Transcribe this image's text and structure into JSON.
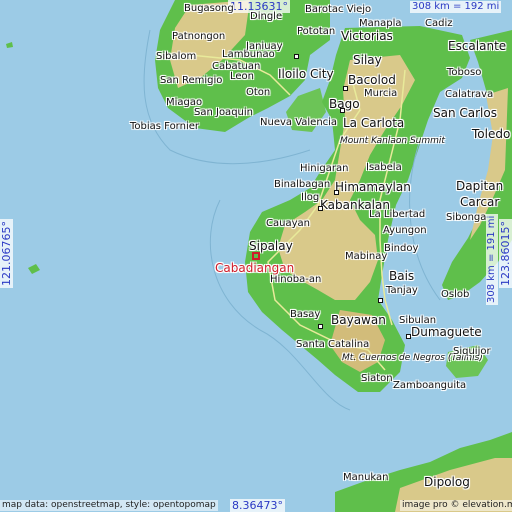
{
  "coordinates": {
    "north": "11.13631°",
    "south": "8.36473°",
    "west": "121.06765°",
    "east": "123.86015°"
  },
  "scale": {
    "horizontal": "308 km = 192 mi",
    "vertical": "308 km = 191 mi"
  },
  "attribution": {
    "left": "map data: openstreetmap, style: opentopomap",
    "right": "image pro © elevation.maps"
  },
  "highlight": {
    "name": "Cabadiangan",
    "color": "#d11d2a"
  },
  "colors": {
    "sea": "#9ccbe6",
    "lowland": "#5fbf4b",
    "hills": "#d9c98a",
    "coordinate_text": "#2a39c4"
  },
  "places": [
    {
      "name": "Bugasong"
    },
    {
      "name": "Dingle"
    },
    {
      "name": "Barotac Viejo"
    },
    {
      "name": "Cadiz"
    },
    {
      "name": "Patnongon"
    },
    {
      "name": "Pototan"
    },
    {
      "name": "Manapla"
    },
    {
      "name": "Victorias"
    },
    {
      "name": "Janiuay"
    },
    {
      "name": "Silay"
    },
    {
      "name": "Escalante"
    },
    {
      "name": "Lambunao"
    },
    {
      "name": "Cabatuan"
    },
    {
      "name": "Toboso"
    },
    {
      "name": "Sibalom"
    },
    {
      "name": "Leon"
    },
    {
      "name": "Iloilo City"
    },
    {
      "name": "Bacolod"
    },
    {
      "name": "Calatrava"
    },
    {
      "name": "Oton"
    },
    {
      "name": "Murcia"
    },
    {
      "name": "San Remigio"
    },
    {
      "name": "Miagao"
    },
    {
      "name": "San Joaquin"
    },
    {
      "name": "Bago"
    },
    {
      "name": "San Carlos"
    },
    {
      "name": "Nueva Valencia"
    },
    {
      "name": "Tobias Fornier"
    },
    {
      "name": "La Carlota"
    },
    {
      "name": "Toledo"
    },
    {
      "name": "Hinigaran"
    },
    {
      "name": "Isabela"
    },
    {
      "name": "Himamaylan"
    },
    {
      "name": "Binalbagan"
    },
    {
      "name": "Dapitan"
    },
    {
      "name": "Ilog"
    },
    {
      "name": "Kabankalan"
    },
    {
      "name": "Carcar"
    },
    {
      "name": "Cauayan"
    },
    {
      "name": "La Libertad"
    },
    {
      "name": "Sibonga"
    },
    {
      "name": "Ayungon"
    },
    {
      "name": "Sipalay"
    },
    {
      "name": "Cabadiangan"
    },
    {
      "name": "Bindoy"
    },
    {
      "name": "Mabinay"
    },
    {
      "name": "Hinoba-an"
    },
    {
      "name": "Bais"
    },
    {
      "name": "Tanjay"
    },
    {
      "name": "Oslob"
    },
    {
      "name": "Basay"
    },
    {
      "name": "Bayawan"
    },
    {
      "name": "Sibulan"
    },
    {
      "name": "Dumaguete"
    },
    {
      "name": "Santa Catalina"
    },
    {
      "name": "Siquijor"
    },
    {
      "name": "Siaton"
    },
    {
      "name": "Zamboanguita"
    },
    {
      "name": "Dipolog"
    },
    {
      "name": "Manukan"
    }
  ],
  "peaks": [
    {
      "name": "Mount Kanlaon Summit"
    },
    {
      "name": "Mt. Cuernos de Negros (Talinis)"
    }
  ]
}
